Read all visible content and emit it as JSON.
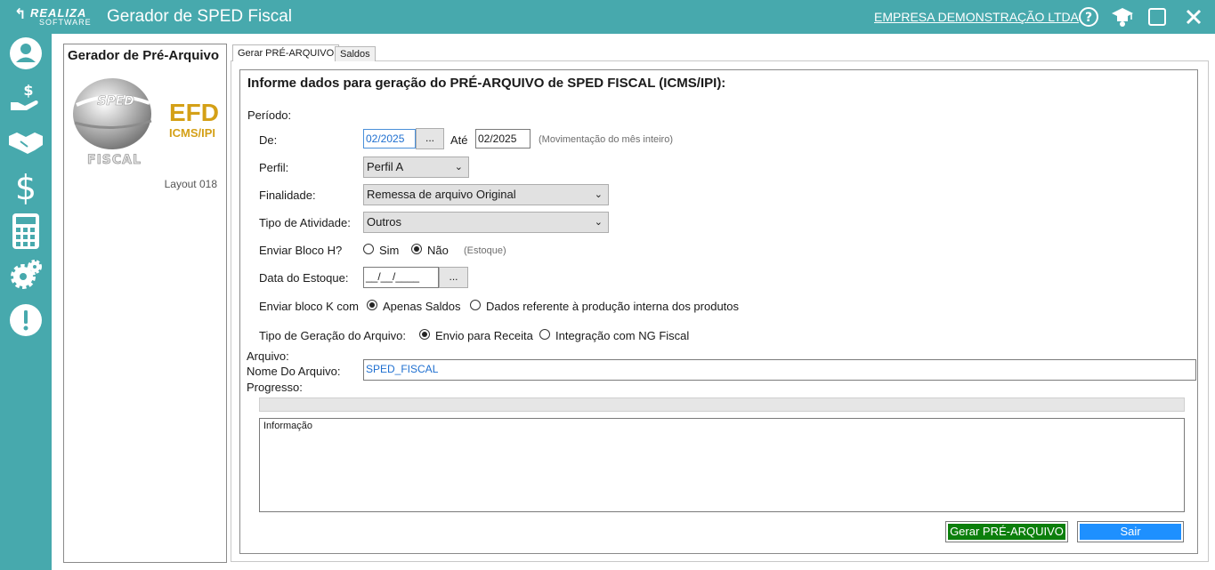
{
  "header": {
    "brand_top": "REALIZA",
    "brand_bottom": "SOFTWARE",
    "app_title": "Gerador de SPED Fiscal",
    "company": "EMPRESA DEMONSTRAÇÃO LTDA",
    "icons": [
      "help-icon",
      "graduation-cap-icon",
      "maximize-icon",
      "close-icon"
    ]
  },
  "sidebar": {
    "icons": [
      "user-icon",
      "hand-money-icon",
      "handshake-icon",
      "dollar-icon",
      "calculator-icon",
      "settings-gears-icon",
      "alert-icon"
    ]
  },
  "left_panel": {
    "title": "Gerador de Pré-Arquivo",
    "logo_sped": "SPED",
    "logo_fiscal": "FISCAL",
    "logo_efd": "EFD",
    "logo_icms": "ICMS/IPI",
    "layout": "Layout 018"
  },
  "tabs": [
    {
      "label": "Gerar PRÉ-ARQUIVO",
      "active": true
    },
    {
      "label": "Saldos",
      "active": false
    }
  ],
  "form": {
    "heading": "Informe dados para geração do PRÉ-ARQUIVO de SPED FISCAL (ICMS/IPI):",
    "periodo_label": "Período:",
    "de_label": "De:",
    "de_value": "02/2025",
    "picker_label": "...",
    "ate_label": "Até",
    "ate_value": "02/2025",
    "periodo_hint": "(Movimentação do mês inteiro)",
    "perfil_label": "Perfil:",
    "perfil_value": "Perfil A",
    "finalidade_label": "Finalidade:",
    "finalidade_value": "Remessa de arquivo Original",
    "atividade_label": "Tipo de Atividade:",
    "atividade_value": "Outros",
    "bloco_h_label": "Enviar Bloco H?",
    "bloco_h_sim": "Sim",
    "bloco_h_nao": "Não",
    "bloco_h_selected": "Não",
    "bloco_h_hint": "(Estoque)",
    "estoque_label": "Data do Estoque:",
    "estoque_value": "__/__/____",
    "bloco_k_label": "Enviar bloco K com",
    "bloco_k_opt1": "Apenas Saldos",
    "bloco_k_opt2": "Dados referente à produção interna dos produtos",
    "bloco_k_selected": "Apenas Saldos",
    "geracao_label": "Tipo de Geração do Arquivo:",
    "geracao_opt1": "Envio para Receita",
    "geracao_opt2": "Integração com NG Fiscal",
    "geracao_selected": "Envio para Receita",
    "arquivo_label": "Arquivo:",
    "nome_label": "Nome Do Arquivo:",
    "nome_value": "SPED_FISCAL",
    "progresso_label": "Progresso:",
    "progress": 0,
    "info_label": "Informação"
  },
  "buttons": {
    "gerar": "Gerar PRÉ-ARQUIVO",
    "sair": "Sair"
  },
  "colors": {
    "teal": "#47a9ad",
    "gerar_bg": "#0c7f0c",
    "sair_bg": "#1e90ff",
    "input_text_blue": "#1e6fd0",
    "logo_gold": "#d4a017"
  }
}
